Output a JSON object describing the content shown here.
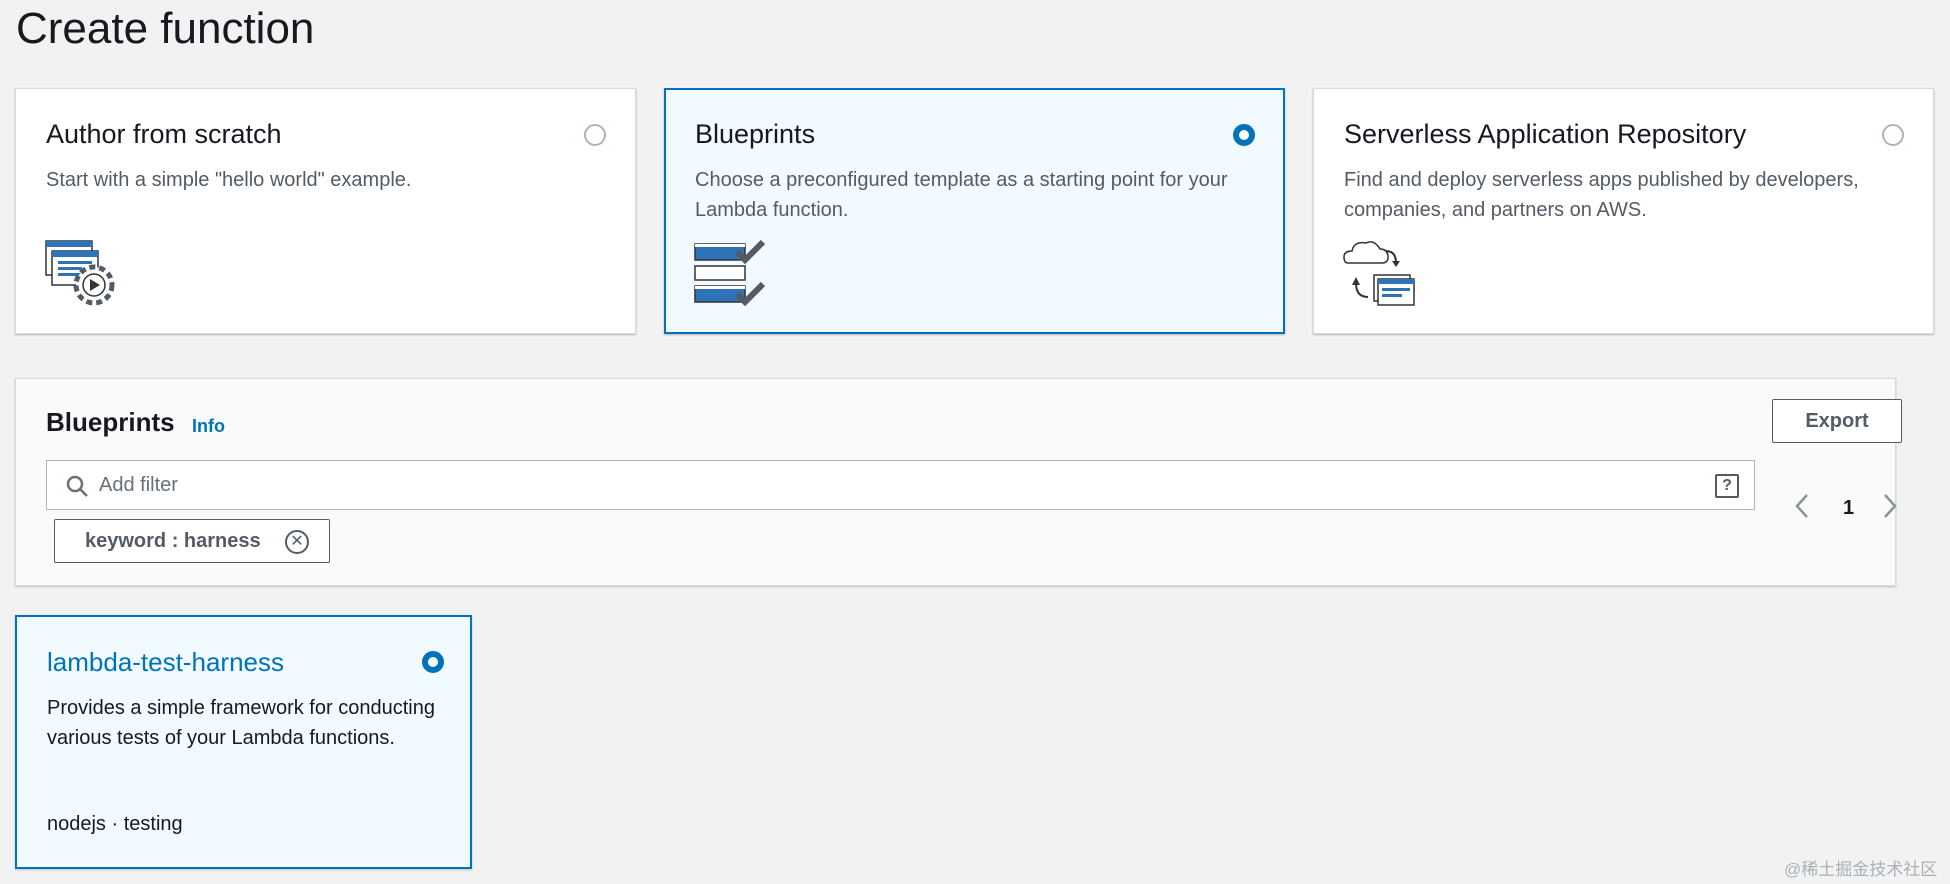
{
  "page": {
    "title": "Create function"
  },
  "options": [
    {
      "title": "Author from scratch",
      "description": "Start with a simple \"hello world\" example.",
      "selected": false,
      "icon": "code-gear-icon"
    },
    {
      "title": "Blueprints",
      "description": "Choose a preconfigured template as a starting point for your Lambda function.",
      "selected": true,
      "icon": "checklist-icon"
    },
    {
      "title": "Serverless Application Repository",
      "description": "Find and deploy serverless apps published by developers, companies, and partners on AWS.",
      "selected": false,
      "icon": "cloud-sync-icon"
    }
  ],
  "blueprints": {
    "heading": "Blueprints",
    "info_link": "Info",
    "export_label": "Export",
    "filter": {
      "placeholder": "Add filter",
      "value": ""
    },
    "token": {
      "label": "keyword : harness"
    },
    "pagination": {
      "current_page": "1",
      "prev_icon": "chevron-left-icon",
      "next_icon": "chevron-right-icon"
    }
  },
  "results": [
    {
      "title": "lambda-test-harness",
      "description": "Provides a simple framework for conducting various tests of your Lambda functions.",
      "tags": "nodejs · testing",
      "selected": true
    }
  ],
  "watermark": "@稀土掘金技术社区",
  "colors": {
    "accent": "#0073bb",
    "selected_bg": "#f1faff",
    "page_bg": "#f2f2f2",
    "text": "#16191f",
    "muted": "#545b64"
  }
}
